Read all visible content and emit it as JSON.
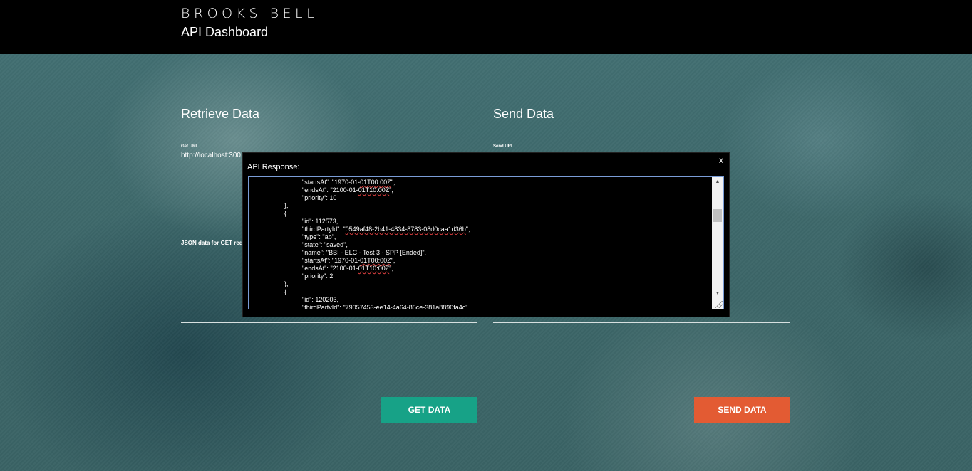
{
  "header": {
    "logo_text": "BROOKS BELL",
    "app_title": "API Dashboard"
  },
  "retrieve": {
    "title": "Retrieve Data",
    "url_label": "Get URL",
    "url_value": "http://localhost:300",
    "json_label": "JSON data for GET reque"
  },
  "send": {
    "title": "Send Data",
    "url_label": "Send URL"
  },
  "buttons": {
    "get_data": "GET DATA",
    "send_data": "SEND DATA"
  },
  "modal": {
    "close_label": "x",
    "label": "API Response:",
    "lines": [
      {
        "indent": 2,
        "key": "\"startsAt\"",
        "sep": ": ",
        "pre": "\"1970-01-",
        "sq": "01T00:00Z",
        "post": "\","
      },
      {
        "indent": 2,
        "key": "\"endsAt\"",
        "sep": ": ",
        "pre": "\"2100-01-",
        "sq": "01T10:00Z",
        "post": "\","
      },
      {
        "indent": 2,
        "key": "\"priority\"",
        "sep": ": ",
        "pre": "10",
        "sq": "",
        "post": ""
      },
      {
        "indent": 1,
        "key": "},",
        "sep": "",
        "pre": "",
        "sq": "",
        "post": ""
      },
      {
        "indent": 1,
        "key": "{",
        "sep": "",
        "pre": "",
        "sq": "",
        "post": ""
      },
      {
        "indent": 2,
        "key": "\"id\"",
        "sep": ": ",
        "pre": "112573,",
        "sq": "",
        "post": ""
      },
      {
        "indent": 2,
        "key": "\"thirdPartyId\"",
        "sep": ": ",
        "pre": "\"",
        "sq": "0549af48-2b41-4834-8783-08d0caa1d36b",
        "post": "\","
      },
      {
        "indent": 2,
        "key": "\"type\"",
        "sep": ": ",
        "pre": "\"ab\",",
        "sq": "",
        "post": ""
      },
      {
        "indent": 2,
        "key": "\"state\"",
        "sep": ": ",
        "pre": "\"saved\",",
        "sq": "",
        "post": ""
      },
      {
        "indent": 2,
        "key": "\"name\"",
        "sep": ": ",
        "pre": "\"BBI - ELC - Test 3 - SPP [Ended]\",",
        "sq": "",
        "post": ""
      },
      {
        "indent": 2,
        "key": "\"startsAt\"",
        "sep": ": ",
        "pre": "\"1970-01-",
        "sq": "01T00:00Z",
        "post": "\","
      },
      {
        "indent": 2,
        "key": "\"endsAt\"",
        "sep": ": ",
        "pre": "\"2100-01-",
        "sq": "01T10:00Z",
        "post": "\","
      },
      {
        "indent": 2,
        "key": "\"priority\"",
        "sep": ": ",
        "pre": "2",
        "sq": "",
        "post": ""
      },
      {
        "indent": 1,
        "key": "},",
        "sep": "",
        "pre": "",
        "sq": "",
        "post": ""
      },
      {
        "indent": 1,
        "key": "{",
        "sep": "",
        "pre": "",
        "sq": "",
        "post": ""
      },
      {
        "indent": 2,
        "key": "\"id\"",
        "sep": ": ",
        "pre": "120203,",
        "sq": "",
        "post": ""
      },
      {
        "indent": 2,
        "key": "\"thirdPartyId\"",
        "sep": ": ",
        "pre": "\"",
        "sq": "79057453-ee14-4a64-85ce-381a8890fa4c",
        "post": "\","
      }
    ]
  },
  "colors": {
    "get_button": "#17a287",
    "send_button": "#e35b33",
    "header_bg": "#000000",
    "page_bg": "#3d6a6c"
  },
  "icons": {
    "scroll_up": "triangle-up-icon",
    "scroll_down": "triangle-down-icon",
    "resize": "resize-grip-icon"
  }
}
